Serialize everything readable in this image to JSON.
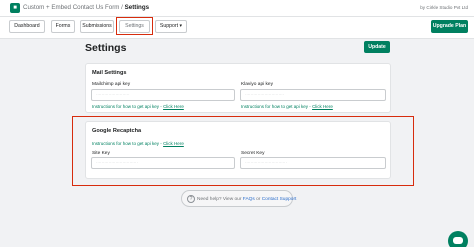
{
  "app": {
    "icon_glyph": "■",
    "breadcrumb_prefix": "Custom + Embed Contact Us Form",
    "breadcrumb_sep": " / ",
    "breadcrumb_current": "Settings",
    "brand": "by Cirkle Studio Pvt Ltd"
  },
  "nav": {
    "tabs": [
      "Dashboard",
      "Forms",
      "Submissions",
      "Settings",
      "Support ▾"
    ],
    "active": "Settings",
    "upgrade_label": "Upgrade Plan"
  },
  "page": {
    "title": "Settings",
    "update_label": "Update"
  },
  "mail_settings": {
    "title": "Mail Settings",
    "mailchimp_label": "Mailchimp api key",
    "mailchimp_value": "························",
    "mailchimp_help": "Instructions for how to get api key -",
    "mailchimp_link": "Click Here",
    "klaviyo_label": "Klaviyo api key",
    "klaviyo_value": "····························",
    "klaviyo_help": "Instructions for how to get api key -",
    "klaviyo_link": "Click Here"
  },
  "recaptcha": {
    "title": "Google Recaptcha",
    "help": "Instructions for how to get api key -",
    "link": "Click Here",
    "site_key_label": "Site Key",
    "site_key_value": "······························",
    "secret_key_label": "Secret Key",
    "secret_key_value": "······························"
  },
  "help_footer": {
    "icon_glyph": "?",
    "prefix": "Need help? View our ",
    "faqs": "FAQs",
    "or": " or ",
    "contact": "Contact Support"
  },
  "icons": {
    "app": "app-logo-icon",
    "help": "question-circle-icon",
    "chat": "chat-icon"
  },
  "colors": {
    "primary": "#008060",
    "highlight": "#d72c0d",
    "link": "#2c6ecb",
    "background": "#f1f2f4"
  }
}
